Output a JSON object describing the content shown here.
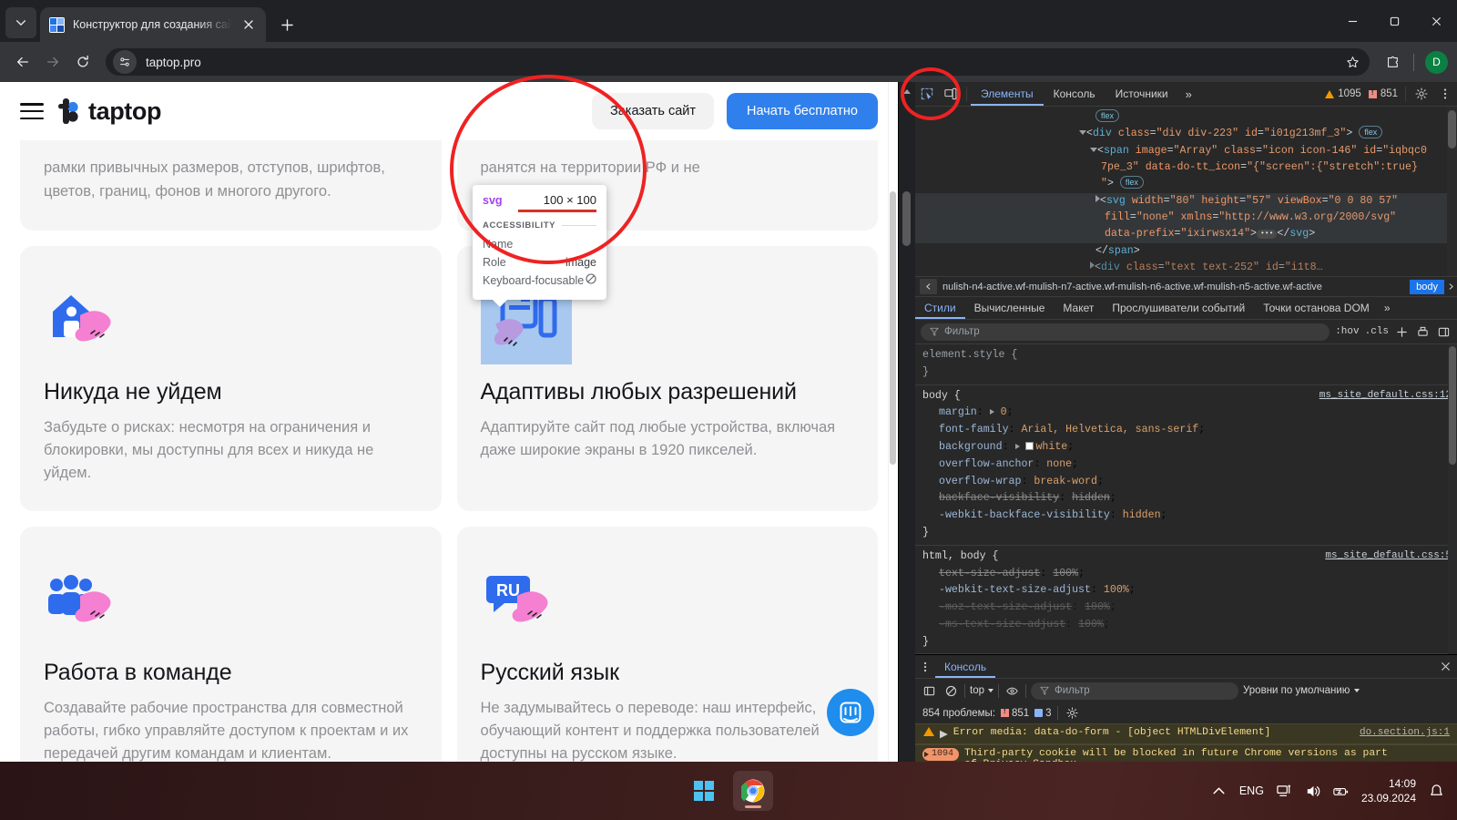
{
  "browser": {
    "tab": {
      "title": "Конструктор для создания сай",
      "favicon": "taptop-favicon"
    },
    "new_tab_label": "+",
    "omnibox": {
      "url": "taptop.pro",
      "site_info_icon": "tune-icon",
      "bookmark_icon": "star-icon"
    },
    "nav": {
      "back": "back-arrow",
      "forward": "forward-arrow",
      "reload": "reload-icon"
    },
    "extensions_icon": "extensions-puzzle-icon",
    "profile_initial": "D",
    "window_controls": {
      "minimize": "–",
      "maximize": "□",
      "close": "×"
    }
  },
  "page": {
    "brand": "taptop",
    "header_buttons": {
      "secondary": "Заказать сайт",
      "primary": "Начать бесплатно"
    },
    "clipped_cards": [
      {
        "text": "рамки привычных размеров, отступов, шрифтов, цветов, границ, фонов и многого другого."
      },
      {
        "text": "ранятся на территории РФ и не"
      }
    ],
    "cards": [
      {
        "icon": "house-hand-icon",
        "title": "Никуда не уйдем",
        "text": "Забудьте о рисках: несмотря на ограничения и блокировки, мы доступны для всех и никуда не уйдем."
      },
      {
        "icon": "layout-hand-icon",
        "title": "Адаптивы любых разрешений",
        "text": "Адаптируйте сайт под любые устройства, включая даже широкие экраны в 1920 пикселей."
      },
      {
        "icon": "people-hand-icon",
        "title": "Работа в команде",
        "text": "Создавайте рабочие пространства для совместной работы, гибко управляйте доступом к проектам и их передачей другим командам и клиентам."
      },
      {
        "icon": "ru-hand-icon",
        "title": "Русский язык",
        "text": "Не задумывайтесь о переводе: наш интерфейс, обучающий контент и поддержка пользователей доступны на русском языке."
      }
    ],
    "intercom_icon": "intercom-chat-icon"
  },
  "inspect_tooltip": {
    "tag": "svg",
    "dimensions": "100 × 100",
    "section_label": "ACCESSIBILITY",
    "rows": [
      {
        "label": "Name",
        "value": ""
      },
      {
        "label": "Role",
        "value": "image"
      },
      {
        "label": "Keyboard-focusable",
        "value": "no-icon"
      }
    ]
  },
  "devtools": {
    "toolbar": {
      "inspect_icon": "inspect-cursor-icon",
      "device_icon": "device-toolbar-icon",
      "tabs": [
        {
          "label": "Элементы",
          "active": true
        },
        {
          "label": "Консоль",
          "active": false
        },
        {
          "label": "Источники",
          "active": false
        }
      ],
      "more_tabs": "»",
      "warning_count": "1095",
      "error_count": "851",
      "settings_icon": "gear-icon",
      "menu_icon": "kebab-menu-icon"
    },
    "dom_lines": [
      {
        "indent": 10,
        "chip_only": true,
        "chip": "flex"
      },
      {
        "indent": 9,
        "tri": "open",
        "html": "<div class=\"div div-223\" id=\"i01g213mf_3\">",
        "chip": "flex"
      },
      {
        "indent": 10,
        "tri": "open",
        "html": "<span image=\"Array\" class=\"icon icon-146\" id=\"iqbqc0"
      },
      {
        "indent": 11,
        "cont": "7pe_3\" data-do-tt_icon=\"{\"screen\":{\"stretch\":true}"
      },
      {
        "indent": 11,
        "cont": "\">",
        "chip": "flex"
      },
      {
        "indent": 12,
        "tri": "closed",
        "selected": true,
        "html": "<svg width=\"80\" height=\"57\" viewBox=\"0 0 80 57\""
      },
      {
        "indent": 13,
        "selected": true,
        "cont": "fill=\"none\" xmlns=\"http://www.w3.org/2000/svg\""
      },
      {
        "indent": 13,
        "selected": true,
        "cont": "data-prefix=\"ixirwsx14\">",
        "ellipsis": true,
        "tail": "</svg>"
      },
      {
        "indent": 11,
        "close": "</span>"
      }
    ],
    "breadcrumb": {
      "path": "nulish-n4-active.wf-mulish-n7-active.wf-mulish-n6-active.wf-mulish-n5-active.wf-active",
      "selected": "body"
    },
    "styles_tabs": [
      {
        "label": "Стили",
        "active": true
      },
      {
        "label": "Вычисленные",
        "active": false
      },
      {
        "label": "Макет",
        "active": false
      },
      {
        "label": "Прослушиватели событий",
        "active": false
      },
      {
        "label": "Точки останова DOM",
        "active": false
      }
    ],
    "styles_more": "»",
    "filter": {
      "placeholder": "Фильтр",
      "hov": ":hov",
      "cls": ".cls",
      "plus": "+"
    },
    "rules": [
      {
        "selector": "element.style {",
        "close": "}",
        "source": "",
        "declarations": []
      },
      {
        "selector": "body {",
        "close": "}",
        "source": "ms_site_default.css:12",
        "declarations": [
          {
            "prop": "margin",
            "value": "0",
            "arrow": true,
            "struck": false
          },
          {
            "prop": "font-family",
            "value": "Arial, Helvetica, sans-serif",
            "struck": false
          },
          {
            "prop": "background",
            "value": "white",
            "arrow": true,
            "swatch": true,
            "struck": false
          },
          {
            "prop": "overflow-anchor",
            "value": "none",
            "struck": false
          },
          {
            "prop": "overflow-wrap",
            "value": "break-word",
            "struck": false
          },
          {
            "prop": "backface-visibility",
            "value": "hidden",
            "struck": true
          },
          {
            "prop": "-webkit-backface-visibility",
            "value": "hidden",
            "struck": false
          }
        ]
      },
      {
        "selector": "html, body {",
        "close": "}",
        "source": "ms_site_default.css:5",
        "declarations": [
          {
            "prop": "text-size-adjust",
            "value": "100%",
            "struck": true
          },
          {
            "prop": "-webkit-text-size-adjust",
            "value": "100%",
            "struck": false
          },
          {
            "prop": "-moz-text-size-adjust",
            "value": "100%",
            "struck": true,
            "dim": true
          },
          {
            "prop": "-ms-text-size-adjust",
            "value": "100%",
            "struck": true,
            "dim": true
          }
        ]
      }
    ],
    "drawer": {
      "tab": "Консоль",
      "close_icon": "close-icon",
      "toolbar": {
        "sidebar_icon": "console-sidebar-icon",
        "clear_icon": "clear-console-icon",
        "context": "top",
        "eye_icon": "live-expression-icon",
        "filter_placeholder": "Фильтр",
        "levels": "Уровни по умолчанию"
      },
      "problems_summary": {
        "text": "854 проблемы:",
        "errors": "851",
        "info": "3",
        "gear_icon": "gear-icon"
      },
      "messages": [
        {
          "type": "warning",
          "text": "Error media: data-do-form - [object HTMLDivElement]",
          "source": "do.section.js:1",
          "expandable": true
        },
        {
          "type": "warning",
          "count": "1094",
          "text": "Third-party cookie will be blocked in future Chrome versions as part of Privacy Sandbox.",
          "source": ""
        }
      ],
      "prompt": ">"
    }
  },
  "taskbar": {
    "start_icon": "windows-start-icon",
    "apps": [
      {
        "name": "chrome-icon",
        "active": true
      }
    ],
    "tray": {
      "overflow_icon": "chevron-up-icon",
      "language": "ENG",
      "network_icon": "network-icon",
      "volume_icon": "volume-icon",
      "battery_icon": "battery-icon",
      "time": "14:09",
      "date": "23.09.2024",
      "notification_icon": "bell-icon"
    }
  },
  "colors": {
    "accent_blue": "#2f80ed",
    "devtools_link": "#8ab4f8",
    "warning": "#f29900",
    "error": "#f28b82",
    "annotation_red": "#ef2222"
  }
}
